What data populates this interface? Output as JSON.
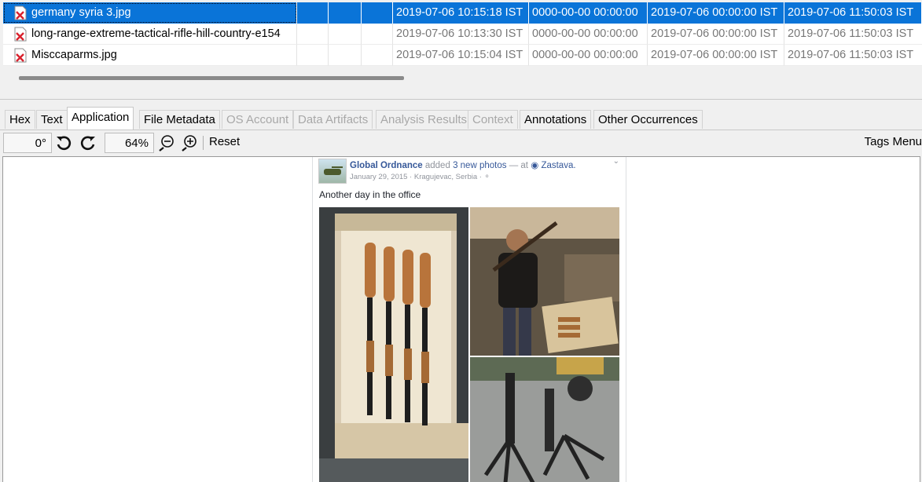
{
  "files": [
    {
      "name": "germany syria 3.jpg",
      "created": "2019-07-06 10:15:18 IST",
      "accessed": "0000-00-00 00:00:00",
      "changed": "2019-07-06 00:00:00 IST",
      "modified": "2019-07-06 11:50:03 IST",
      "selected": true
    },
    {
      "name": "long-range-extreme-tactical-rifle-hill-country-e154",
      "created": "2019-07-06 10:13:30 IST",
      "accessed": "0000-00-00 00:00:00",
      "changed": "2019-07-06 00:00:00 IST",
      "modified": "2019-07-06 11:50:03 IST",
      "selected": false
    },
    {
      "name": "Misccaparms.jpg",
      "created": "2019-07-06 10:15:04 IST",
      "accessed": "0000-00-00 00:00:00",
      "changed": "2019-07-06 00:00:00 IST",
      "modified": "2019-07-06 11:50:03 IST",
      "selected": false
    }
  ],
  "tabs": [
    {
      "label": "Hex",
      "state": "normal"
    },
    {
      "label": "Text",
      "state": "normal"
    },
    {
      "label": "Application",
      "state": "active"
    },
    {
      "label": "File Metadata",
      "state": "normal"
    },
    {
      "label": "OS Account",
      "state": "disabled"
    },
    {
      "label": "Data Artifacts",
      "state": "disabled"
    },
    {
      "label": "Analysis Results",
      "state": "disabled"
    },
    {
      "label": "Context",
      "state": "disabled"
    },
    {
      "label": "Annotations",
      "state": "normal"
    },
    {
      "label": "Other Occurrences",
      "state": "normal"
    }
  ],
  "toolbar": {
    "rotation": "0°",
    "zoom": "64%",
    "reset_label": "Reset",
    "tags_menu_label": "Tags Menu",
    "icons": [
      "rotate-left-icon",
      "rotate-right-icon",
      "zoom-out-icon",
      "zoom-in-icon"
    ]
  },
  "post": {
    "page_name": "Global Ordnance",
    "action": "added",
    "photos_link": "3 new photos",
    "at": "— at",
    "location": "Zastava.",
    "date_line": "January 29, 2015 · Kragujevac, Serbia ·",
    "text": "Another day in the office"
  },
  "colors": {
    "selection": "#0a74d8",
    "link": "#365899",
    "disabled_text": "#a8a8a8",
    "file_icon_red": "#d9202c"
  }
}
